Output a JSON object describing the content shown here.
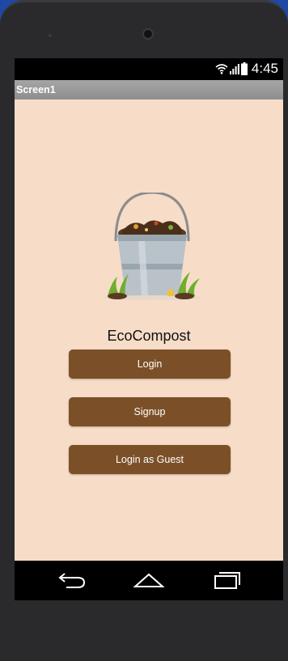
{
  "status_bar": {
    "time": "4:45"
  },
  "title_bar": {
    "title": "Screen1"
  },
  "app": {
    "name": "EcoCompost"
  },
  "buttons": {
    "login": "Login",
    "signup": "Signup",
    "guest": "Login as Guest"
  },
  "colors": {
    "screen_background": "#f7dcc8",
    "button": "#7b5028",
    "title_bar": "#9a9a9a"
  },
  "icons": {
    "wifi": "wifi-icon",
    "signal": "signal-icon",
    "battery": "battery-icon",
    "back": "back-icon",
    "home": "home-icon",
    "recents": "recents-icon",
    "logo": "compost-bucket-logo"
  }
}
